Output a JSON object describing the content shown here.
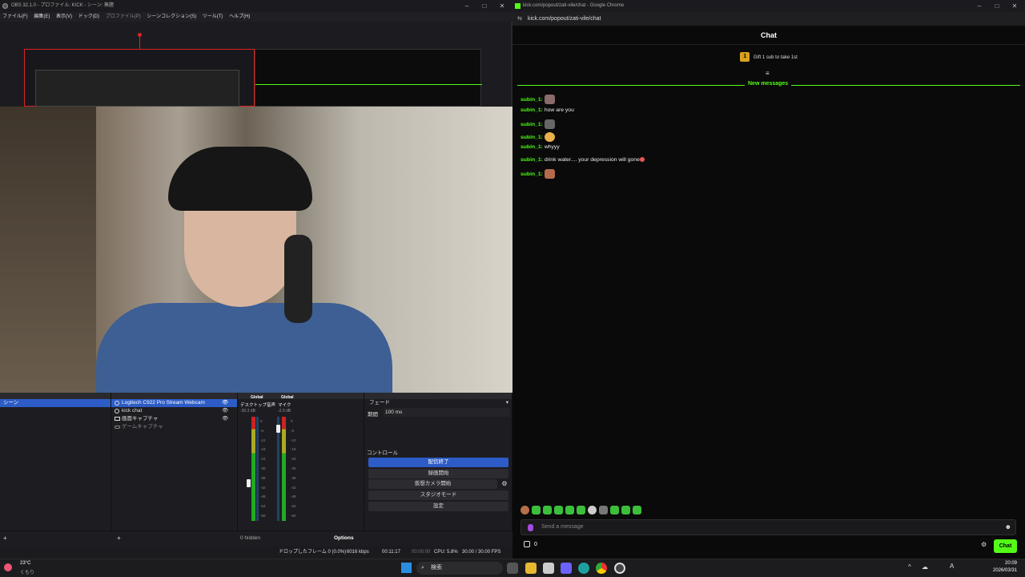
{
  "obs": {
    "title": "OBS 32.1.0 - プロファイル: KICK - シーン: 無題",
    "menu": [
      "ファイル(F)",
      "編集(E)",
      "表示(V)",
      "ドック(D)",
      "プロファイル(P)",
      "シーンコレクション(S)",
      "ツール(T)",
      "ヘルプ(H)"
    ],
    "scene": "シーン",
    "sources": [
      "Logitech C922 Pro Stream Webcam",
      "kick chat",
      "画面キャプチャ",
      "ゲームキャプチャ"
    ],
    "mixer": {
      "global1": "Global",
      "global2": "Global",
      "ch1_name": "デスクトップ音声",
      "ch1_db": "-30.3 dB",
      "ch2_name": "マイク",
      "ch2_db": "-2.0 dB",
      "ticks": [
        "0",
        "-6",
        "-12",
        "-18",
        "-24",
        "-30",
        "-36",
        "-42",
        "-48",
        "-54",
        "-60"
      ],
      "hidden": "0 hidden"
    },
    "transition": {
      "type": "フェード",
      "duration_label": "期間",
      "duration": "100 ms"
    },
    "controls": {
      "header": "コントロール",
      "stop_stream": "配信終了",
      "record": "録画開始",
      "virtual_cam": "仮想カメラ開始",
      "studio": "スタジオモード",
      "settings": "設定"
    },
    "options": "Options",
    "status": {
      "dropped": "ドロップしたフレーム 0 (0.0%)",
      "bitrate": "6016 kbps",
      "stream_time": "00:11:17",
      "rec_time": "00:00:00",
      "cpu": "CPU: 5.8%",
      "fps": "30.00 / 30.00 FPS"
    }
  },
  "chrome": {
    "title": "kick.com/popout/zati-vile/chat - Google Chrome",
    "url": "kick.com/popout/zati-vile/chat",
    "chat_title": "Chat",
    "gift_badge": "1",
    "gift_text": "Gift 1 sub to take 1st",
    "new_messages": "New messages",
    "messages": [
      {
        "user": "subin_1:",
        "text": ""
      },
      {
        "user": "subin_1:",
        "text": "how are you"
      },
      {
        "user": "subin_1:",
        "text": ""
      },
      {
        "user": "subin_1:",
        "text": ""
      },
      {
        "user": "subin_1:",
        "text": "whyyy"
      },
      {
        "user": "subin_1:",
        "text": "drink water.... your depression will gone"
      },
      {
        "user": "subin_1:",
        "text": ""
      }
    ],
    "input_placeholder": "Send a message",
    "viewer_count": "0",
    "chat_button": "Chat"
  },
  "taskbar": {
    "temp": "23°C",
    "weather": "くもり",
    "search": "検索",
    "time": "20:09",
    "date": "2026/03/31"
  },
  "colors": {
    "kick_green": "#53fc18",
    "obs_blue": "#2d5cc6"
  }
}
